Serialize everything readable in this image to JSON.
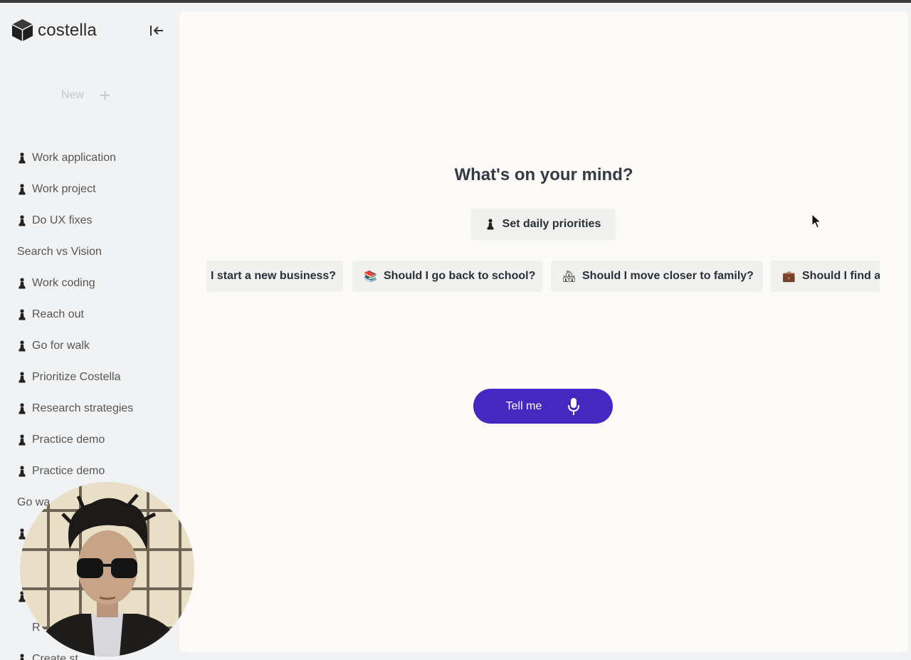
{
  "app": {
    "name": "costella"
  },
  "sidebar": {
    "new_label": "New",
    "items": [
      {
        "label": "Work application",
        "icon": "pawn-icon"
      },
      {
        "label": "Work project",
        "icon": "pawn-icon"
      },
      {
        "label": "Do UX fixes",
        "icon": "pawn-icon"
      },
      {
        "label": "Search vs Vision",
        "icon": ""
      },
      {
        "label": "Work coding",
        "icon": "pawn-icon"
      },
      {
        "label": "Reach out",
        "icon": "pawn-icon"
      },
      {
        "label": "Go for walk",
        "icon": "pawn-icon"
      },
      {
        "label": "Prioritize Costella",
        "icon": "pawn-icon"
      },
      {
        "label": "Research strategies",
        "icon": "pawn-icon"
      },
      {
        "label": "Practice demo",
        "icon": "pawn-icon"
      },
      {
        "label": "Practice demo",
        "icon": "pawn-icon"
      },
      {
        "label": "Go wa",
        "icon": "pawn-icon"
      }
    ],
    "partial_items": [
      "R",
      "Create st"
    ]
  },
  "main": {
    "heading": "What's on your mind?",
    "primary_suggestion": {
      "label": "Set daily priorities",
      "icon": "pawn-icon"
    },
    "suggestions": [
      {
        "label": "I start a new business?",
        "emoji": ""
      },
      {
        "label": "Should I go back to school?",
        "emoji": "📚"
      },
      {
        "label": "Should I move closer to family?",
        "emoji": "🏘"
      },
      {
        "label": "Should I find a",
        "emoji": "💼"
      }
    ],
    "tell_button": {
      "label": "Tell me",
      "icon": "microphone-icon"
    }
  },
  "colors": {
    "accent": "#4527c2",
    "sidebar_bg": "#f1f2f4",
    "main_bg": "#fbfaf6",
    "chip_bg": "#f0f0ee"
  }
}
